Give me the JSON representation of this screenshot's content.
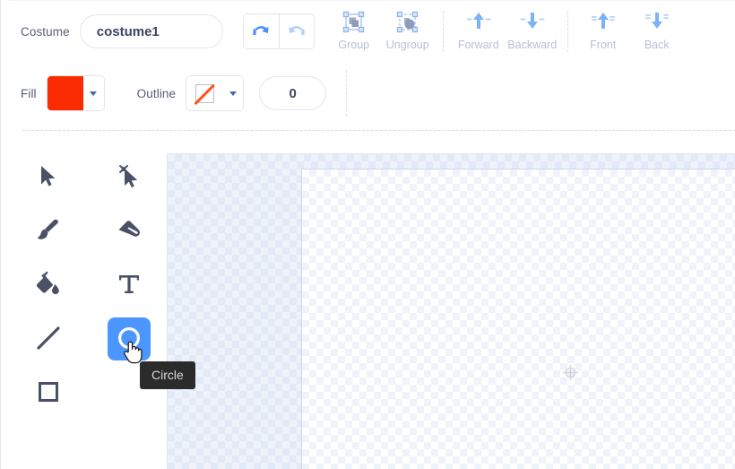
{
  "costume": {
    "label": "Costume",
    "name_value": "costume1",
    "name_placeholder": "costume1"
  },
  "history": {
    "undo": {
      "name": "undo-button",
      "label": "Undo",
      "enabled": true,
      "color": "#4c8dfa"
    },
    "redo": {
      "name": "redo-button",
      "label": "Redo",
      "enabled": false,
      "color": "#b0d0fb"
    }
  },
  "object_ops": [
    {
      "label": "Group",
      "icon": "group-icon",
      "enabled": false
    },
    {
      "label": "Ungroup",
      "icon": "ungroup-icon",
      "enabled": false
    },
    {
      "label": "Forward",
      "icon": "forward-icon",
      "enabled": false
    },
    {
      "label": "Backward",
      "icon": "backward-icon",
      "enabled": false
    },
    {
      "label": "Front",
      "icon": "front-icon",
      "enabled": false
    },
    {
      "label": "Back",
      "icon": "back-icon",
      "enabled": false
    }
  ],
  "style": {
    "fill_label": "Fill",
    "fill_color": "#fa2b00",
    "outline_label": "Outline",
    "outline_color": "none",
    "stroke_width_value": "0",
    "stroke_width_placeholder": "0"
  },
  "tools": [
    {
      "id": "select",
      "label": "Select",
      "icon": "select-arrow-icon",
      "selected": false
    },
    {
      "id": "reshape",
      "label": "Reshape",
      "icon": "reshape-icon",
      "selected": false
    },
    {
      "id": "brush",
      "label": "Brush",
      "icon": "brush-icon",
      "selected": false
    },
    {
      "id": "eraser",
      "label": "Eraser",
      "icon": "eraser-icon",
      "selected": false
    },
    {
      "id": "fill",
      "label": "Fill",
      "icon": "paint-bucket-icon",
      "selected": false
    },
    {
      "id": "text",
      "label": "Text",
      "icon": "text-icon",
      "selected": false
    },
    {
      "id": "line",
      "label": "Line",
      "icon": "line-icon",
      "selected": false
    },
    {
      "id": "circle",
      "label": "Circle",
      "icon": "circle-icon",
      "selected": true
    },
    {
      "id": "rect",
      "label": "Rectangle",
      "icon": "rectangle-icon",
      "selected": false
    }
  ],
  "tooltip": {
    "text": "Circle",
    "background": "#2b2b2b"
  },
  "canvas": {
    "center_marker": "canvas-center-crosshair",
    "selected_tool_color": "#4c97ff"
  }
}
